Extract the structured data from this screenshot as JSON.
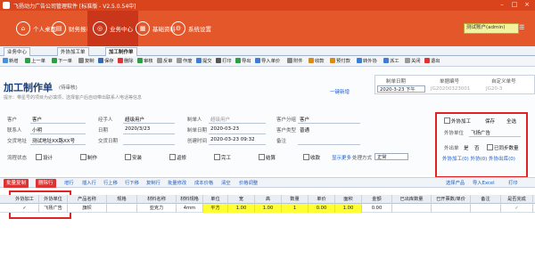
{
  "titlebar": {
    "title": "飞扬动力广告公司管理软件 [标准版 - V2.5.0.54中]"
  },
  "nav": {
    "items": [
      {
        "label": "个人桌面",
        "icon": "desktop-icon"
      },
      {
        "label": "财务报表",
        "icon": "report-icon"
      },
      {
        "label": "业务中心",
        "icon": "business-icon"
      },
      {
        "label": "基础资料",
        "icon": "data-icon"
      },
      {
        "label": "系统设置",
        "icon": "settings-icon"
      }
    ],
    "user": "测试账户(admin)"
  },
  "tabs": [
    "业务中心",
    "外协加工单",
    "加工制作单"
  ],
  "toolbar": {
    "items": [
      "新增",
      "上一单",
      "下一单",
      "复制",
      "保存",
      "删除",
      "审核",
      "反审",
      "作废",
      "提交",
      "打印",
      "导出",
      "导入单价",
      "附件",
      "收款",
      "预付款",
      "转外协",
      "派工",
      "关闭",
      "退出"
    ]
  },
  "form": {
    "title": "加工制作单",
    "status": "(待审核)",
    "note": "提示：带星号的项目为必填项，选择客户后自动带出联系人电话等信息",
    "top_right": {
      "link": "一键新增",
      "date_label": "制单日期",
      "date_value": "2020-3-23 下午",
      "order_label": "单据编号",
      "order_value": "JG20200323001",
      "custom_label": "自定义单号",
      "custom_value": "JG20-3"
    },
    "fields": {
      "customer_label": "客户",
      "customer_value": "客户",
      "contact_label": "联系人",
      "contact_value": "小明",
      "address_label": "交货地址",
      "address_value": "测试地址XX路XX号",
      "person_label": "经手人",
      "person_value": "超级用户",
      "date_label": "日期",
      "date_value": "2020/3/23",
      "delivery_label": "交货日期",
      "delivery_value": "",
      "maker_label": "制单人",
      "maker_value": "超级用户",
      "maketime_label": "制单日期",
      "maketime_value": "2020-03-23",
      "created_label": "创建时间",
      "created_value": "2020-03-23 09:32",
      "ctype_label": "客户类型",
      "ctype_value": "普通",
      "group_label": "客户分组",
      "group_value": "客户",
      "remark_label": "备注",
      "remark_value": "",
      "flow_label": "流程状态",
      "flows": [
        "设计",
        "制作",
        "安装",
        "返修",
        "完工",
        "结算",
        "收款"
      ],
      "expand": "显示更多",
      "process_label": "处理方式",
      "process_value": "正常"
    },
    "redbox": {
      "outsource_label": "外协加工",
      "save_label": "保存",
      "all_label": "全选",
      "supplier_label": "外协单位",
      "supplier_value": "飞扬广告",
      "inner_label": "外出单",
      "opt1": "是",
      "opt2": "否",
      "opt3": "已同步数量",
      "links": "外协加工(0)  外协(0)  外协出库(0)"
    }
  },
  "grid_toolbar": {
    "btn1": "批量复制",
    "btn2": "删除行",
    "links": [
      "增行",
      "插入行",
      "行上移",
      "行下移",
      "复制行",
      "批量修改",
      "成本价格",
      "清空",
      "价格调整"
    ],
    "right_links": [
      "选择产品",
      "导入Excel",
      "打印"
    ]
  },
  "grid": {
    "headers": [
      "外协加工",
      "外协单位",
      "产品名称",
      "规格",
      "材料名称",
      "材料规格",
      "单位",
      "宽",
      "高",
      "数量",
      "单价",
      "面积",
      "金额",
      "已出库数量",
      "已开票数/单价",
      "备注",
      "是否完成"
    ],
    "rows": [
      [
        "✓",
        "飞扬广告",
        "旗帜",
        "",
        "亚克力",
        "4mm",
        "平方",
        "1.00",
        "1.00",
        "1",
        "0.00",
        "1.00",
        "0.00",
        "",
        "",
        "",
        "✓"
      ]
    ]
  },
  "colors": {
    "brand": "#e4572a",
    "titlebar": "#d9441c",
    "highlight": "#ffff33",
    "redbox": "#e02424"
  }
}
